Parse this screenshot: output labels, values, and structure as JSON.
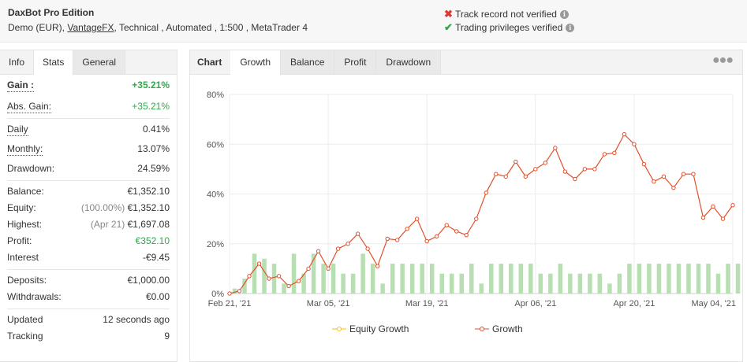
{
  "header": {
    "title": "DaxBot Pro Edition",
    "account_type": "Demo (EUR),",
    "broker": "VantageFX",
    "details": ", Technical , Automated , 1:500 , MetaTrader 4",
    "status_1": "Track record not verified",
    "status_2": "Trading privileges verified",
    "status_1_icon": "x-mark-icon",
    "status_2_icon": "check-mark-icon"
  },
  "left_tabs": [
    "Info",
    "Stats",
    "General"
  ],
  "stats": {
    "gain_label": "Gain :",
    "gain_value": "+35.21%",
    "abs_gain_label": "Abs. Gain:",
    "abs_gain_value": "+35.21%",
    "daily_label": "Daily",
    "daily_value": "0.41%",
    "monthly_label": "Monthly:",
    "monthly_value": "13.07%",
    "drawdown_label": "Drawdown:",
    "drawdown_value": "24.59%",
    "balance_label": "Balance:",
    "balance_value": "€1,352.10",
    "equity_label": "Equity:",
    "equity_pct": "(100.00%)",
    "equity_value": "€1,352.10",
    "highest_label": "Highest:",
    "highest_date": "(Apr 21)",
    "highest_value": "€1,697.08",
    "profit_label": "Profit:",
    "profit_value": "€352.10",
    "interest_label": "Interest",
    "interest_value": "-€9.45",
    "deposits_label": "Deposits:",
    "deposits_value": "€1,000.00",
    "withdrawals_label": "Withdrawals:",
    "withdrawals_value": "€0.00",
    "updated_label": "Updated",
    "updated_value": "12 seconds ago",
    "tracking_label": "Tracking",
    "tracking_value": "9"
  },
  "chart_tabs": [
    "Chart",
    "Growth",
    "Balance",
    "Profit",
    "Drawdown"
  ],
  "menu_icon": "ellipsis-icon",
  "colors": {
    "growth_line": "#e0502a",
    "equity_line": "#f2c21b",
    "bars": "#b7dfb2",
    "positive": "#2eaa4a",
    "negative_mark": "#e0382e"
  },
  "chart_data": {
    "type": "line",
    "x_ticks": [
      "Feb 21, '21",
      "Mar 05, '21",
      "Mar 19, '21",
      "Apr 06, '21",
      "Apr 20, '21",
      "May 04, '21"
    ],
    "y_ticks": [
      "0%",
      "20%",
      "40%",
      "60%",
      "80%"
    ],
    "ylim": [
      0,
      80
    ],
    "legend": [
      "Equity Growth",
      "Growth"
    ],
    "legend_position": "bottom",
    "grid": true,
    "growth_values": [
      0,
      1,
      7,
      12,
      6,
      7,
      3,
      5,
      10,
      17,
      10,
      18,
      20,
      24,
      18,
      11,
      22,
      21.5,
      26,
      30,
      21,
      23,
      27.5,
      25,
      23.5,
      30,
      40.5,
      48,
      47,
      53,
      47,
      50,
      52.5,
      58.5,
      49,
      46,
      50,
      50,
      56,
      56.5,
      64,
      60,
      52,
      45,
      47,
      42.5,
      48,
      48,
      30.5,
      35,
      30,
      35.5
    ],
    "bar_values": [
      2,
      6,
      16,
      14,
      12,
      4,
      16,
      8,
      16,
      12,
      12,
      8,
      8,
      16,
      12,
      4,
      12,
      12,
      12,
      12,
      12,
      8,
      8,
      8,
      12,
      4,
      12,
      12,
      12,
      12,
      12,
      8,
      8,
      12,
      8,
      8,
      8,
      8,
      4,
      8,
      12,
      12,
      12,
      12,
      12,
      12,
      12,
      12,
      12,
      8,
      12,
      12
    ]
  }
}
